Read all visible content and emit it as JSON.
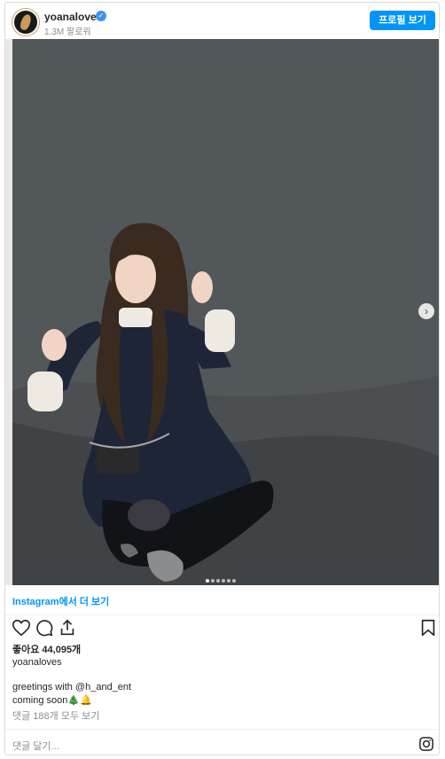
{
  "header": {
    "username": "yoanaloves",
    "verified_icon": "verified-badge-icon",
    "followers": "1.3M 팔로워",
    "profile_button": "프로필 보기"
  },
  "post": {
    "carousel": {
      "total": 6,
      "active": 1
    },
    "view_more": "Instagram에서 더 보기",
    "likes": "좋아요 44,095개",
    "poster": "yoanaloves",
    "caption_line1": "greetings with @h_and_ent",
    "caption_line2": "coming soon🎄🔔",
    "comments_link": "댓글 188개 모두 보기",
    "comment_placeholder": "댓글 달기..."
  },
  "icons": {
    "like": "heart-icon",
    "comment": "comment-icon",
    "share": "share-icon",
    "save": "bookmark-icon",
    "next": "chevron-right-icon",
    "instagram": "instagram-icon"
  },
  "colors": {
    "accent": "#0095f6",
    "muted": "#8e8e8e",
    "text": "#262626"
  }
}
